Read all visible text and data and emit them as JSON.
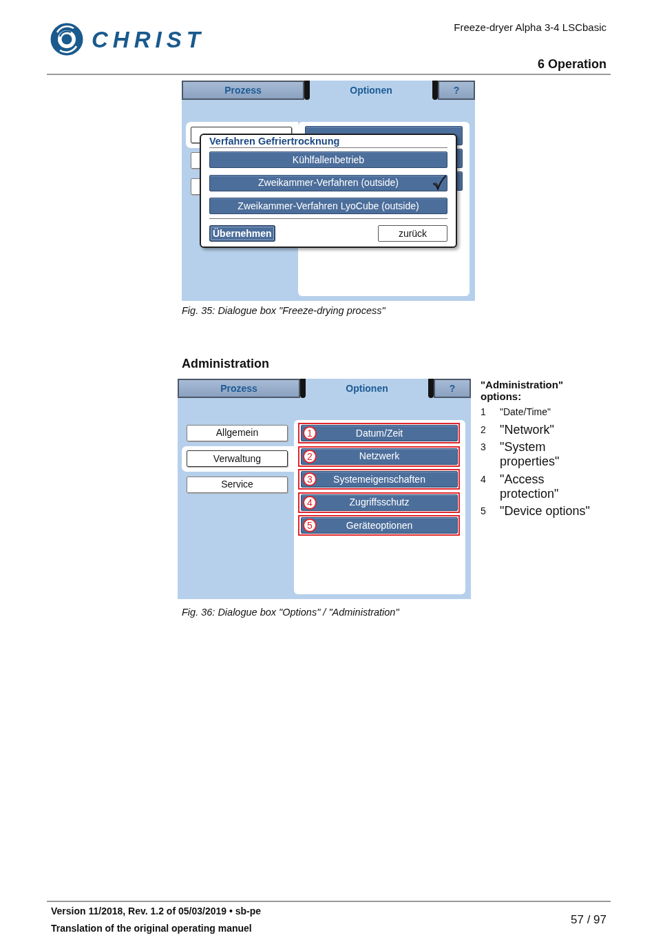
{
  "header": {
    "logo_text": "CHRIST",
    "product": "Freeze-dryer Alpha 3-4 LSCbasic",
    "chapter": "6 Operation"
  },
  "figure_35": {
    "screen": {
      "tabs": [
        {
          "label": "Prozess",
          "selected": false
        },
        {
          "label": "Optionen",
          "selected": true
        },
        {
          "label": "?",
          "selected": false
        }
      ],
      "categories": [
        {
          "selected": true
        },
        {
          "selected": false
        },
        {
          "selected": false
        }
      ],
      "dialog": {
        "title": "Verfahren Gefriertrocknung",
        "options": [
          {
            "label": "Kühlfallenbetrieb",
            "checked": false
          },
          {
            "label": "Zweikammer-Verfahren (outside)",
            "checked": true
          },
          {
            "label": "Zweikammer-Verfahren LyoCube (outside)",
            "checked": false
          }
        ],
        "buttons": [
          {
            "label": "Übernehmen",
            "kind": "primary"
          },
          {
            "label": "zurück",
            "kind": "secondary"
          }
        ]
      }
    },
    "caption": "Fig. 35: Dialogue box \"Freeze-drying process\""
  },
  "section_heading": "Administration",
  "figure_36": {
    "screen": {
      "tabs": [
        {
          "label": "Prozess",
          "selected": false
        },
        {
          "label": "Optionen",
          "selected": true
        },
        {
          "label": "?",
          "selected": false
        }
      ],
      "categories": [
        {
          "label": "Allgemein",
          "selected": false
        },
        {
          "label": "Verwaltung",
          "selected": true
        },
        {
          "label": "Service",
          "selected": false
        }
      ],
      "options": [
        {
          "callout": "1",
          "label": "Datum/Zeit"
        },
        {
          "callout": "2",
          "label": "Netzwerk"
        },
        {
          "callout": "3",
          "label": "Systemeigenschaften"
        },
        {
          "callout": "4",
          "label": "Zugriffsschutz"
        },
        {
          "callout": "5",
          "label": "Geräteoptionen"
        }
      ]
    },
    "legend": {
      "title": "\"Administration\" options:",
      "items": [
        {
          "number": "1",
          "text": "\"Date/Time\""
        },
        {
          "number": "2",
          "text": "\"Network\""
        },
        {
          "number": "3",
          "text": "\"System properties\""
        },
        {
          "number": "4",
          "text": "\"Access protection\""
        },
        {
          "number": "5",
          "text": "\"Device options\""
        }
      ]
    },
    "caption": "Fig. 36: Dialogue box \"Options\" / \"Administration\""
  },
  "footer": {
    "version": "Version 11/2018, Rev. 1.2 of 05/03/2019 • sb-pe",
    "note": "Translation of the original operating manuel",
    "page": "57 / 97"
  }
}
